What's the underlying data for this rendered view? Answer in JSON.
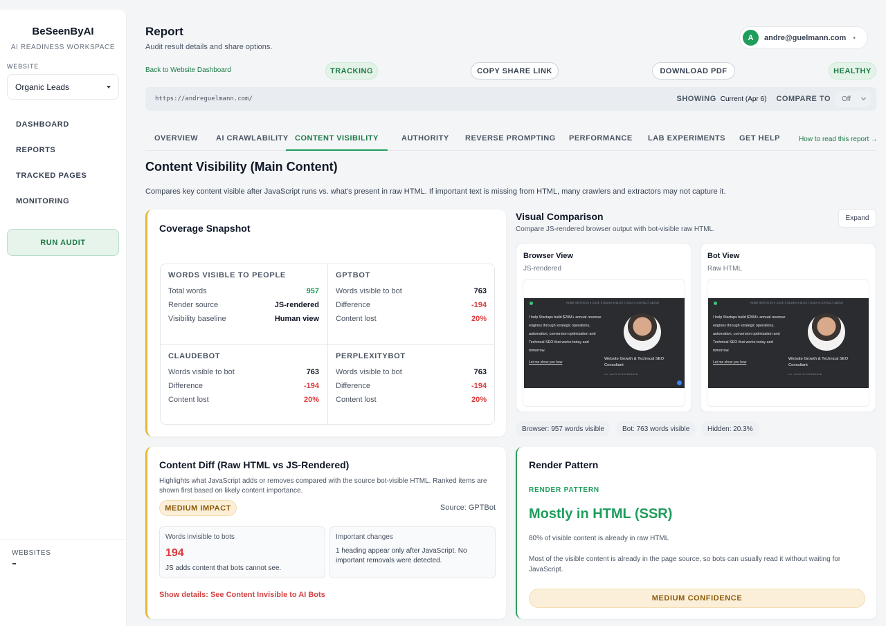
{
  "sidebar": {
    "brand": "BeSeenByAI",
    "subtitle": "AI READINESS WORKSPACE",
    "website_label": "WEBSITE",
    "website_value": "Organic Leads",
    "nav": [
      "DASHBOARD",
      "REPORTS",
      "TRACKED PAGES",
      "MONITORING"
    ],
    "run_audit": "RUN AUDIT",
    "websites_label": "WEBSITES"
  },
  "header": {
    "title": "Report",
    "subtitle": "Audit result details and share options.",
    "user_initial": "A",
    "user_email": "andre@guelmann.com"
  },
  "actions": {
    "back_link": "Back to Website Dashboard",
    "tracking": "TRACKING",
    "copy_share": "COPY SHARE LINK",
    "download_pdf": "DOWNLOAD PDF",
    "status": "HEALTHY"
  },
  "url_bar": {
    "url": "https://andreguelmann.com/",
    "showing_label": "SHOWING",
    "showing_value": "Current (Apr 6)",
    "compare_label": "COMPARE TO",
    "compare_value": "Off"
  },
  "tabs": [
    "OVERVIEW",
    "AI CRAWLABILITY",
    "CONTENT VISIBILITY",
    "AUTHORITY",
    "REVERSE PROMPTING",
    "PERFORMANCE",
    "LAB EXPERIMENTS",
    "GET HELP"
  ],
  "active_tab": "CONTENT VISIBILITY",
  "help_link": "How to read this report →",
  "section": {
    "title": "Content Visibility (Main Content)",
    "description": "Compares key content visible after JavaScript runs vs. what's present in raw HTML. If important text is missing from HTML, many crawlers and extractors may not capture it."
  },
  "coverage": {
    "title": "Coverage Snapshot",
    "people": {
      "heading": "WORDS VISIBLE TO PEOPLE",
      "rows": [
        {
          "label": "Total words",
          "value": "957"
        },
        {
          "label": "Render source",
          "value": "JS-rendered"
        },
        {
          "label": "Visibility baseline",
          "value": "Human view"
        }
      ]
    },
    "gptbot": {
      "heading": "GPTBOT",
      "rows": [
        {
          "label": "Words visible to bot",
          "value": "763"
        },
        {
          "label": "Difference",
          "value": "-194"
        },
        {
          "label": "Content lost",
          "value": "20%"
        }
      ]
    },
    "claudebot": {
      "heading": "CLAUDEBOT",
      "rows": [
        {
          "label": "Words visible to bot",
          "value": "763"
        },
        {
          "label": "Difference",
          "value": "-194"
        },
        {
          "label": "Content lost",
          "value": "20%"
        }
      ]
    },
    "perplexitybot": {
      "heading": "PERPLEXITYBOT",
      "rows": [
        {
          "label": "Words visible to bot",
          "value": "763"
        },
        {
          "label": "Difference",
          "value": "-194"
        },
        {
          "label": "Content lost",
          "value": "20%"
        }
      ]
    }
  },
  "visual": {
    "title": "Visual Comparison",
    "subtitle": "Compare JS-rendered browser output with bot-visible raw HTML.",
    "expand": "Expand",
    "browser": {
      "title": "Browser View",
      "sub": "JS-rendered"
    },
    "bot": {
      "title": "Bot View",
      "sub": "Raw HTML"
    },
    "preview": {
      "nav": "HOME    SERVICES ▾    CASE STUDIES ▾    BLOG    TOOLS ▾    CONTACT    ABOUT",
      "hero": "I help Startups build $20M+ annual revenue engines through strategic operations, automation, conversion optimization and Technical SEO that works today and tomorrow.",
      "cta": "Let me show you how",
      "role": "Website Growth & Technical SEO Consultant",
      "tiny": "15+ YEARS OF EXPERIENCE"
    },
    "chips": [
      "Browser: 957 words visible",
      "Bot: 763 words visible",
      "Hidden: 20.3%"
    ]
  },
  "diff": {
    "title": "Content Diff (Raw HTML vs JS-Rendered)",
    "description": "Highlights what JavaScript adds or removes compared with the source bot-visible HTML. Ranked items are shown first based on likely content importance.",
    "impact": "MEDIUM IMPACT",
    "source": "Source: GPTBot",
    "invisible_label": "Words invisible to bots",
    "invisible_count": "194",
    "invisible_note": "JS adds content that bots cannot see.",
    "changes_label": "Important changes",
    "changes_text": "1 heading appear only after JavaScript. No important removals were detected.",
    "details_link": "Show details: See Content Invisible to AI Bots"
  },
  "render": {
    "title": "Render Pattern",
    "label": "RENDER PATTERN",
    "headline": "Mostly in HTML (SSR)",
    "stat": "80% of visible content is already in raw HTML",
    "description": "Most of the visible content is already in the page source, so bots can usually read it without waiting for JavaScript.",
    "confidence": "MEDIUM CONFIDENCE"
  }
}
